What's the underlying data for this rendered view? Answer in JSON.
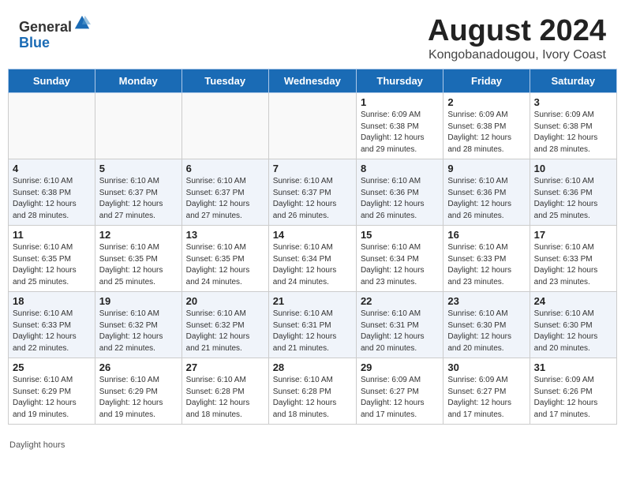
{
  "header": {
    "logo_line1": "General",
    "logo_line2": "Blue",
    "main_title": "August 2024",
    "sub_title": "Kongobanadougou, Ivory Coast"
  },
  "days_of_week": [
    "Sunday",
    "Monday",
    "Tuesday",
    "Wednesday",
    "Thursday",
    "Friday",
    "Saturday"
  ],
  "weeks": [
    [
      {
        "day": "",
        "info": ""
      },
      {
        "day": "",
        "info": ""
      },
      {
        "day": "",
        "info": ""
      },
      {
        "day": "",
        "info": ""
      },
      {
        "day": "1",
        "info": "Sunrise: 6:09 AM\nSunset: 6:38 PM\nDaylight: 12 hours\nand 29 minutes."
      },
      {
        "day": "2",
        "info": "Sunrise: 6:09 AM\nSunset: 6:38 PM\nDaylight: 12 hours\nand 28 minutes."
      },
      {
        "day": "3",
        "info": "Sunrise: 6:09 AM\nSunset: 6:38 PM\nDaylight: 12 hours\nand 28 minutes."
      }
    ],
    [
      {
        "day": "4",
        "info": "Sunrise: 6:10 AM\nSunset: 6:38 PM\nDaylight: 12 hours\nand 28 minutes."
      },
      {
        "day": "5",
        "info": "Sunrise: 6:10 AM\nSunset: 6:37 PM\nDaylight: 12 hours\nand 27 minutes."
      },
      {
        "day": "6",
        "info": "Sunrise: 6:10 AM\nSunset: 6:37 PM\nDaylight: 12 hours\nand 27 minutes."
      },
      {
        "day": "7",
        "info": "Sunrise: 6:10 AM\nSunset: 6:37 PM\nDaylight: 12 hours\nand 26 minutes."
      },
      {
        "day": "8",
        "info": "Sunrise: 6:10 AM\nSunset: 6:36 PM\nDaylight: 12 hours\nand 26 minutes."
      },
      {
        "day": "9",
        "info": "Sunrise: 6:10 AM\nSunset: 6:36 PM\nDaylight: 12 hours\nand 26 minutes."
      },
      {
        "day": "10",
        "info": "Sunrise: 6:10 AM\nSunset: 6:36 PM\nDaylight: 12 hours\nand 25 minutes."
      }
    ],
    [
      {
        "day": "11",
        "info": "Sunrise: 6:10 AM\nSunset: 6:35 PM\nDaylight: 12 hours\nand 25 minutes."
      },
      {
        "day": "12",
        "info": "Sunrise: 6:10 AM\nSunset: 6:35 PM\nDaylight: 12 hours\nand 25 minutes."
      },
      {
        "day": "13",
        "info": "Sunrise: 6:10 AM\nSunset: 6:35 PM\nDaylight: 12 hours\nand 24 minutes."
      },
      {
        "day": "14",
        "info": "Sunrise: 6:10 AM\nSunset: 6:34 PM\nDaylight: 12 hours\nand 24 minutes."
      },
      {
        "day": "15",
        "info": "Sunrise: 6:10 AM\nSunset: 6:34 PM\nDaylight: 12 hours\nand 23 minutes."
      },
      {
        "day": "16",
        "info": "Sunrise: 6:10 AM\nSunset: 6:33 PM\nDaylight: 12 hours\nand 23 minutes."
      },
      {
        "day": "17",
        "info": "Sunrise: 6:10 AM\nSunset: 6:33 PM\nDaylight: 12 hours\nand 23 minutes."
      }
    ],
    [
      {
        "day": "18",
        "info": "Sunrise: 6:10 AM\nSunset: 6:33 PM\nDaylight: 12 hours\nand 22 minutes."
      },
      {
        "day": "19",
        "info": "Sunrise: 6:10 AM\nSunset: 6:32 PM\nDaylight: 12 hours\nand 22 minutes."
      },
      {
        "day": "20",
        "info": "Sunrise: 6:10 AM\nSunset: 6:32 PM\nDaylight: 12 hours\nand 21 minutes."
      },
      {
        "day": "21",
        "info": "Sunrise: 6:10 AM\nSunset: 6:31 PM\nDaylight: 12 hours\nand 21 minutes."
      },
      {
        "day": "22",
        "info": "Sunrise: 6:10 AM\nSunset: 6:31 PM\nDaylight: 12 hours\nand 20 minutes."
      },
      {
        "day": "23",
        "info": "Sunrise: 6:10 AM\nSunset: 6:30 PM\nDaylight: 12 hours\nand 20 minutes."
      },
      {
        "day": "24",
        "info": "Sunrise: 6:10 AM\nSunset: 6:30 PM\nDaylight: 12 hours\nand 20 minutes."
      }
    ],
    [
      {
        "day": "25",
        "info": "Sunrise: 6:10 AM\nSunset: 6:29 PM\nDaylight: 12 hours\nand 19 minutes."
      },
      {
        "day": "26",
        "info": "Sunrise: 6:10 AM\nSunset: 6:29 PM\nDaylight: 12 hours\nand 19 minutes."
      },
      {
        "day": "27",
        "info": "Sunrise: 6:10 AM\nSunset: 6:28 PM\nDaylight: 12 hours\nand 18 minutes."
      },
      {
        "day": "28",
        "info": "Sunrise: 6:10 AM\nSunset: 6:28 PM\nDaylight: 12 hours\nand 18 minutes."
      },
      {
        "day": "29",
        "info": "Sunrise: 6:09 AM\nSunset: 6:27 PM\nDaylight: 12 hours\nand 17 minutes."
      },
      {
        "day": "30",
        "info": "Sunrise: 6:09 AM\nSunset: 6:27 PM\nDaylight: 12 hours\nand 17 minutes."
      },
      {
        "day": "31",
        "info": "Sunrise: 6:09 AM\nSunset: 6:26 PM\nDaylight: 12 hours\nand 17 minutes."
      }
    ]
  ],
  "footer": {
    "note": "Daylight hours"
  }
}
